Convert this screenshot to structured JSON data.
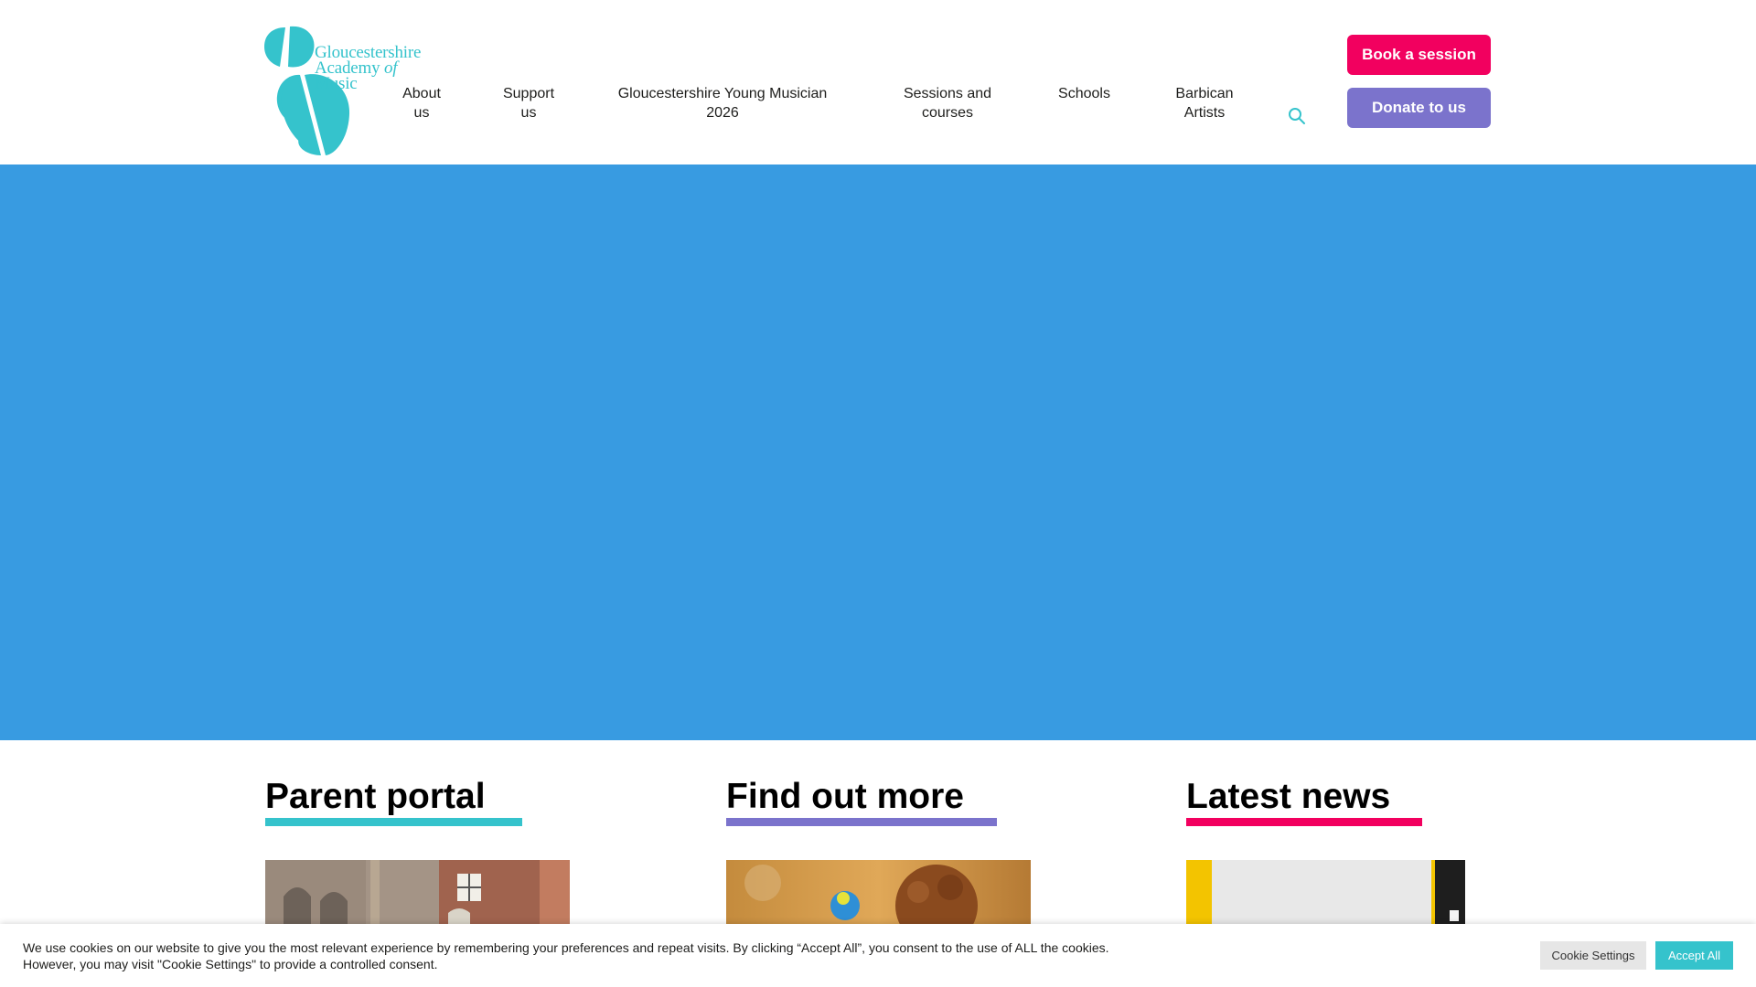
{
  "brand": {
    "logo_lines": [
      "Gloucestershire",
      "Academy",
      "of",
      "Music"
    ],
    "accent_teal": "#35c3cc",
    "accent_pink": "#f2005f",
    "accent_purple": "#7b73cc",
    "hero_blue": "#389be1"
  },
  "nav": {
    "items": [
      {
        "label_line1": "About",
        "label_line2": "us"
      },
      {
        "label_line1": "Support",
        "label_line2": "us"
      },
      {
        "label_line1": "Gloucestershire Young Musician",
        "label_line2": "2026"
      },
      {
        "label_line1": "Sessions and",
        "label_line2": "courses"
      },
      {
        "label_line1": "Schools",
        "label_line2": ""
      },
      {
        "label_line1": "Barbican",
        "label_line2": "Artists"
      }
    ],
    "search_icon": "search-icon"
  },
  "actions": {
    "book_label": "Book a session",
    "donate_label": "Donate to us"
  },
  "sections": [
    {
      "title": "Parent portal",
      "underline_color": "#35c3cc"
    },
    {
      "title": "Find out more",
      "underline_color": "#7b73cc"
    },
    {
      "title": "Latest news",
      "underline_color": "#f2005f"
    }
  ],
  "cookie": {
    "message_line1": "We use cookies on our website to give you the most relevant experience by remembering your preferences and repeat visits. By clicking “Accept All”, you consent to the use of ALL the cookies.",
    "message_line2": "However, you may visit \"Cookie Settings\" to provide a controlled consent.",
    "settings_label": "Cookie Settings",
    "accept_label": "Accept All"
  }
}
